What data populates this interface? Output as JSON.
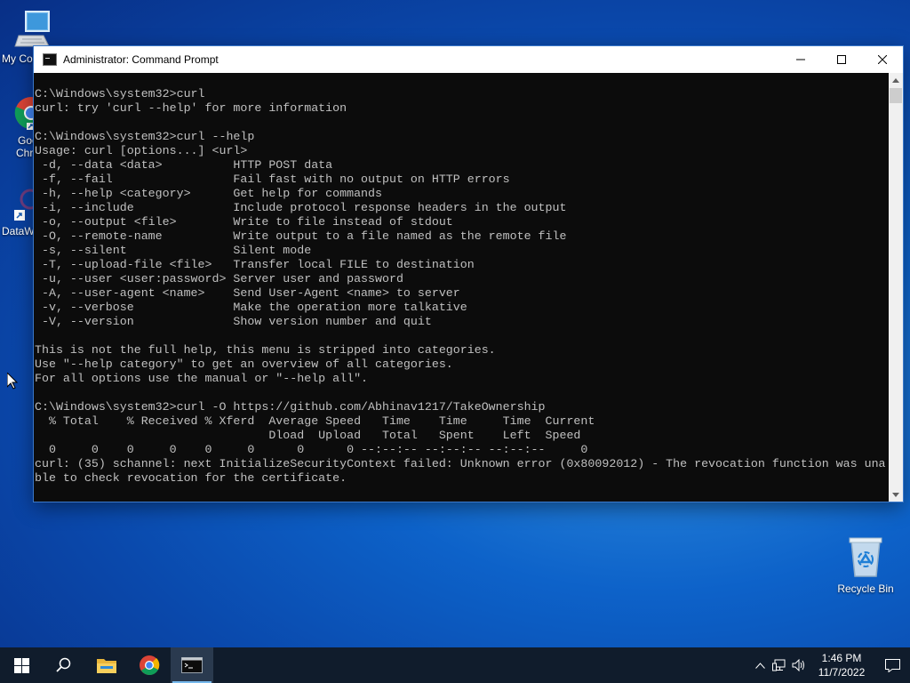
{
  "desktop": {
    "icons": [
      {
        "label": "My Co",
        "icon": "computer-icon"
      },
      {
        "label": "Goo",
        "label2": "Chr",
        "icon": "chrome-icon"
      },
      {
        "label": "DataW",
        "icon": "shortcut-icon"
      },
      {
        "label": "Recycle Bin",
        "icon": "recycle-bin-icon"
      }
    ]
  },
  "window": {
    "title": "Administrator: Command Prompt",
    "lines": [
      "C:\\Windows\\system32>curl",
      "curl: try 'curl --help' for more information",
      "",
      "C:\\Windows\\system32>curl --help",
      "Usage: curl [options...] <url>",
      " -d, --data <data>          HTTP POST data",
      " -f, --fail                 Fail fast with no output on HTTP errors",
      " -h, --help <category>      Get help for commands",
      " -i, --include              Include protocol response headers in the output",
      " -o, --output <file>        Write to file instead of stdout",
      " -O, --remote-name          Write output to a file named as the remote file",
      " -s, --silent               Silent mode",
      " -T, --upload-file <file>   Transfer local FILE to destination",
      " -u, --user <user:password> Server user and password",
      " -A, --user-agent <name>    Send User-Agent <name> to server",
      " -v, --verbose              Make the operation more talkative",
      " -V, --version              Show version number and quit",
      "",
      "This is not the full help, this menu is stripped into categories.",
      "Use \"--help category\" to get an overview of all categories.",
      "For all options use the manual or \"--help all\".",
      "",
      "C:\\Windows\\system32>curl -O https://github.com/Abhinav1217/TakeOwnership",
      "  % Total    % Received % Xferd  Average Speed   Time    Time     Time  Current",
      "                                 Dload  Upload   Total   Spent    Left  Speed",
      "  0     0    0     0    0     0      0      0 --:--:-- --:--:-- --:--:--     0",
      "curl: (35) schannel: next InitializeSecurityContext failed: Unknown error (0x80092012) - The revocation function was una",
      "ble to check revocation for the certificate."
    ]
  },
  "taskbar": {
    "time": "1:46 PM",
    "date": "11/7/2022"
  }
}
